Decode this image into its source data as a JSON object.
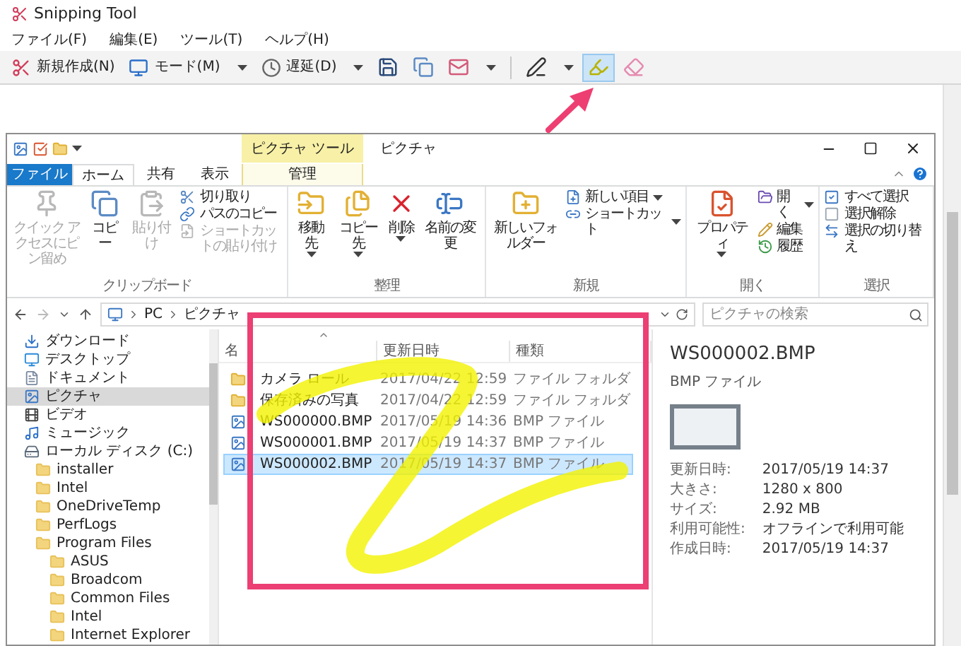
{
  "window": {
    "title": "Snipping Tool"
  },
  "menu": [
    "ファイル(F)",
    "編集(E)",
    "ツール(T)",
    "ヘルプ(H)"
  ],
  "toolbar": [
    {
      "kind": "labeled",
      "label": "新規作成(N)",
      "dropdown": false,
      "selected": false
    },
    {
      "kind": "labeled",
      "label": "モード(M)",
      "dropdown": true,
      "selected": false
    },
    {
      "kind": "labeled",
      "label": "遅延(D)",
      "dropdown": true,
      "selected": false
    },
    {
      "kind": "icon",
      "dropdown": false,
      "selected": false
    },
    {
      "kind": "icon",
      "dropdown": false,
      "selected": false
    },
    {
      "kind": "icon",
      "dropdown": true,
      "selected": false
    },
    {
      "kind": "separator"
    },
    {
      "kind": "icon",
      "dropdown": true,
      "selected": false
    },
    {
      "kind": "icon",
      "dropdown": false,
      "selected": true
    },
    {
      "kind": "icon",
      "dropdown": false,
      "selected": false
    }
  ],
  "explorer": {
    "context_group": "ピクチャ ツール",
    "title": "ピクチャ",
    "tabs": [
      {
        "label": "ファイル",
        "kind": "file",
        "selected": false
      },
      {
        "label": "ホーム",
        "kind": "normal",
        "selected": true
      },
      {
        "label": "共有",
        "kind": "normal",
        "selected": false
      },
      {
        "label": "表示",
        "kind": "normal",
        "selected": false
      },
      {
        "label": "管理",
        "kind": "context",
        "selected": false
      }
    ],
    "ribbon_groups": [
      {
        "label": "クリップボード",
        "items": [
          {
            "kind": "large",
            "label": "クイック アクセスにピン留め",
            "dropdown": false,
            "disabled": true
          },
          {
            "kind": "large",
            "label": "コピー",
            "dropdown": false,
            "disabled": false
          },
          {
            "kind": "large",
            "label": "貼り付け",
            "dropdown": false,
            "disabled": true
          },
          {
            "kind": "small",
            "label": "切り取り",
            "dropdown": false,
            "disabled": false
          },
          {
            "kind": "small",
            "label": "パスのコピー",
            "dropdown": false,
            "disabled": false
          },
          {
            "kind": "small",
            "label": "ショートカットの貼り付け",
            "dropdown": false,
            "disabled": true
          }
        ]
      },
      {
        "label": "整理",
        "items": [
          {
            "kind": "large",
            "label": "移動先",
            "dropdown": true,
            "disabled": false
          },
          {
            "kind": "large",
            "label": "コピー先",
            "dropdown": true,
            "disabled": false
          },
          {
            "kind": "large",
            "label": "削除",
            "dropdown": true,
            "disabled": false
          },
          {
            "kind": "large",
            "label": "名前の変更",
            "dropdown": false,
            "disabled": false
          }
        ]
      },
      {
        "label": "新規",
        "items": [
          {
            "kind": "large",
            "label": "新しいフォルダー",
            "dropdown": false,
            "disabled": false
          },
          {
            "kind": "small",
            "label": "新しい項目",
            "dropdown": true,
            "disabled": false
          },
          {
            "kind": "small",
            "label": "ショートカット",
            "dropdown": true,
            "disabled": false
          }
        ]
      },
      {
        "label": "開く",
        "items": [
          {
            "kind": "large",
            "label": "プロパティ",
            "dropdown": true,
            "disabled": false
          },
          {
            "kind": "small",
            "label": "開く",
            "dropdown": true,
            "disabled": false
          },
          {
            "kind": "small",
            "label": "編集",
            "dropdown": false,
            "disabled": false
          },
          {
            "kind": "small",
            "label": "履歴",
            "dropdown": false,
            "disabled": false
          }
        ]
      },
      {
        "label": "選択",
        "items": [
          {
            "kind": "small",
            "label": "すべて選択",
            "dropdown": false,
            "disabled": false
          },
          {
            "kind": "small",
            "label": "選択解除",
            "dropdown": false,
            "disabled": false
          },
          {
            "kind": "small",
            "label": "選択の切り替え",
            "dropdown": false,
            "disabled": false
          }
        ]
      }
    ],
    "breadcrumbs": [
      "PC",
      "ピクチャ"
    ],
    "search": {
      "placeholder": "ピクチャの検索"
    },
    "nav": [
      {
        "label": "ダウンロード",
        "selected": false
      },
      {
        "label": "デスクトップ",
        "selected": false
      },
      {
        "label": "ドキュメント",
        "selected": false
      },
      {
        "label": "ピクチャ",
        "selected": true
      },
      {
        "label": "ビデオ",
        "selected": false
      },
      {
        "label": "ミュージック",
        "selected": false
      },
      {
        "label": "ローカル ディスク (C:)",
        "selected": false,
        "children": [
          {
            "label": "installer",
            "selected": false
          },
          {
            "label": "Intel",
            "selected": false
          },
          {
            "label": "OneDriveTemp",
            "selected": false
          },
          {
            "label": "PerfLogs",
            "selected": false
          },
          {
            "label": "Program Files",
            "selected": false,
            "children": [
              {
                "label": "ASUS",
                "selected": false
              },
              {
                "label": "Broadcom",
                "selected": false
              },
              {
                "label": "Common Files",
                "selected": false
              },
              {
                "label": "Intel",
                "selected": false
              },
              {
                "label": "Internet Explorer",
                "selected": false
              }
            ]
          }
        ]
      }
    ],
    "file_list": {
      "columns": [
        "名",
        "更新日時",
        "種類"
      ],
      "rows": [
        {
          "name": "カメラ ロール",
          "date": "2017/04/22 12:59",
          "type": "ファイル フォルダ",
          "kind": "folder",
          "selected": false
        },
        {
          "name": "保存済みの写真",
          "date": "2017/04/22 12:59",
          "type": "ファイル フォルダ",
          "kind": "folder",
          "selected": false
        },
        {
          "name": "WS000000.BMP",
          "date": "2017/05/19 14:36",
          "type": "BMP ファイル",
          "kind": "image",
          "selected": false
        },
        {
          "name": "WS000001.BMP",
          "date": "2017/05/19 14:37",
          "type": "BMP ファイル",
          "kind": "image",
          "selected": false
        },
        {
          "name": "WS000002.BMP",
          "date": "2017/05/19 14:37",
          "type": "BMP ファイル",
          "kind": "image",
          "selected": true
        }
      ]
    },
    "details": {
      "name": "WS000002.BMP",
      "type": "BMP ファイル",
      "properties": [
        {
          "label": "更新日時:",
          "value": "2017/05/19 14:37"
        },
        {
          "label": "大きさ:",
          "value": "1280 x 800"
        },
        {
          "label": "サイズ:",
          "value": "2.92 MB"
        },
        {
          "label": "利用可能性:",
          "value": "オフラインで利用可能"
        },
        {
          "label": "作成日時:",
          "value": "2017/05/19 14:37"
        }
      ]
    }
  }
}
